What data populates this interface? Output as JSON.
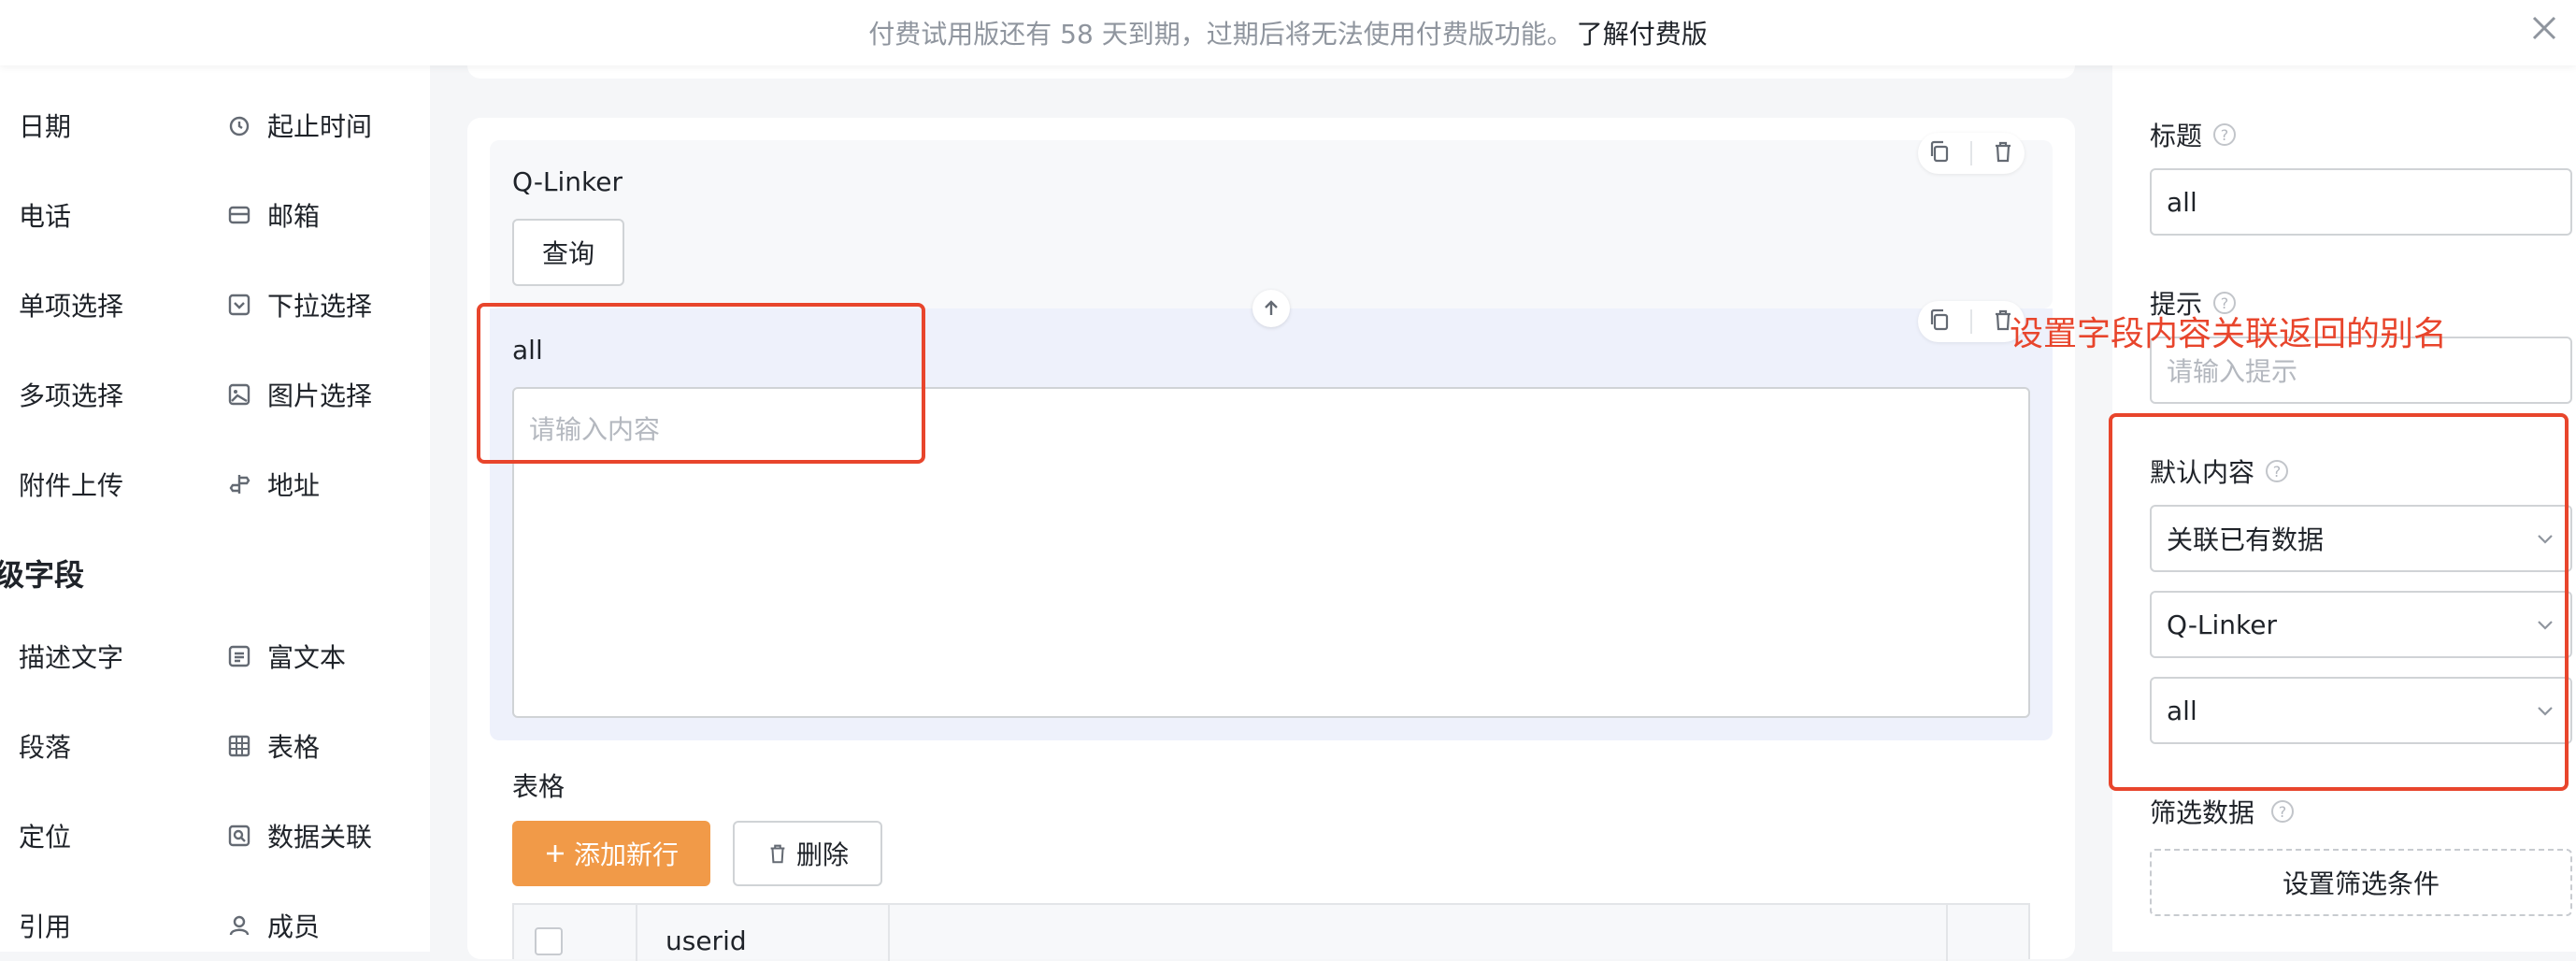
{
  "notice": {
    "text": "付费试用版还有 58 天到期，过期后将无法使用付费版功能。",
    "link": "了解付费版"
  },
  "palette": {
    "items": [
      {
        "label": "日期",
        "icon": "date-icon"
      },
      {
        "label": "起止时间",
        "icon": "time-range-icon"
      },
      {
        "label": "电话",
        "icon": "phone-icon"
      },
      {
        "label": "邮箱",
        "icon": "mail-icon"
      },
      {
        "label": "单项选择",
        "icon": "radio-icon"
      },
      {
        "label": "下拉选择",
        "icon": "dropdown-icon"
      },
      {
        "label": "多项选择",
        "icon": "checkbox-icon"
      },
      {
        "label": "图片选择",
        "icon": "image-icon"
      },
      {
        "label": "附件上传",
        "icon": "attachment-icon"
      },
      {
        "label": "地址",
        "icon": "address-icon"
      }
    ],
    "section_title": "级字段",
    "items2": [
      {
        "label": "描述文字",
        "icon": "text-icon"
      },
      {
        "label": "富文本",
        "icon": "rich-text-icon"
      },
      {
        "label": "段落",
        "icon": "paragraph-icon"
      },
      {
        "label": "表格",
        "icon": "table-icon"
      },
      {
        "label": "定位",
        "icon": "location-icon"
      },
      {
        "label": "数据关联",
        "icon": "data-link-icon"
      },
      {
        "label": "引用",
        "icon": "quote-icon"
      },
      {
        "label": "成员",
        "icon": "member-icon"
      }
    ]
  },
  "canvas": {
    "qlinker_title": "Q-Linker",
    "query_button": "查询",
    "field_label": "all",
    "field_placeholder": "请输入内容",
    "table_title": "表格",
    "add_row_button": "添加新行",
    "delete_button": "删除",
    "table_header_col": "userid"
  },
  "props": {
    "title_label": "标题",
    "title_value": "all",
    "hint_label": "提示",
    "hint_placeholder": "请输入提示",
    "default_label": "默认内容",
    "default_select_1": "关联已有数据",
    "default_select_2": "Q-Linker",
    "default_select_3": "all",
    "filter_label": "筛选数据",
    "filter_button": "设置筛选条件"
  },
  "annotation": {
    "text": "设置字段内容关联返回的别名",
    "color": "#e8452c"
  },
  "colors": {
    "accent_orange": "#f19a48",
    "annotation_red": "#e8452c"
  }
}
